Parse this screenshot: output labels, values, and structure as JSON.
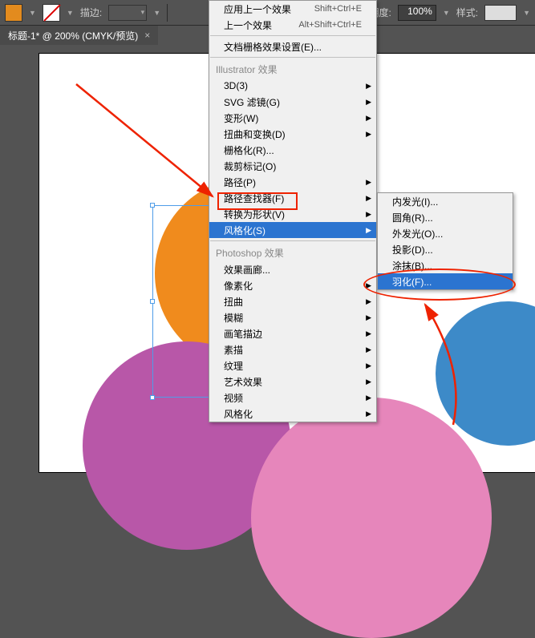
{
  "toolbar": {
    "stroke_label": "描边:",
    "opacity_label": "透明度:",
    "opacity_value": "100%",
    "style_label": "样式:"
  },
  "doc": {
    "title": "标题-1* @ 200% (CMYK/预览)"
  },
  "menu": {
    "apply_last": "应用上一个效果",
    "apply_last_sc": "Shift+Ctrl+E",
    "last_effect": "上一个效果",
    "last_effect_sc": "Alt+Shift+Ctrl+E",
    "raster_settings": "文档栅格效果设置(E)...",
    "sect_illus": "Illustrator 效果",
    "ill": {
      "three_d": "3D(3)",
      "svg": "SVG 滤镜(G)",
      "warp": "变形(W)",
      "distort": "扭曲和变换(D)",
      "rasterize": "栅格化(R)...",
      "crop": "裁剪标记(O)",
      "path": "路径(P)",
      "pathfinder": "路径查找器(F)",
      "convert": "转换为形状(V)",
      "stylize": "风格化(S)"
    },
    "sect_ps": "Photoshop 效果",
    "ps": {
      "gallery": "效果画廊...",
      "pixelate": "像素化",
      "distort": "扭曲",
      "blur": "模糊",
      "brush": "画笔描边",
      "sketch": "素描",
      "texture": "纹理",
      "artistic": "艺术效果",
      "video": "视频",
      "stylize": "风格化"
    }
  },
  "submenu": {
    "inner_glow": "内发光(I)...",
    "round_corners": "圆角(R)...",
    "outer_glow": "外发光(O)...",
    "drop_shadow": "投影(D)...",
    "scribble": "涂抹(B)...",
    "feather": "羽化(F)..."
  }
}
